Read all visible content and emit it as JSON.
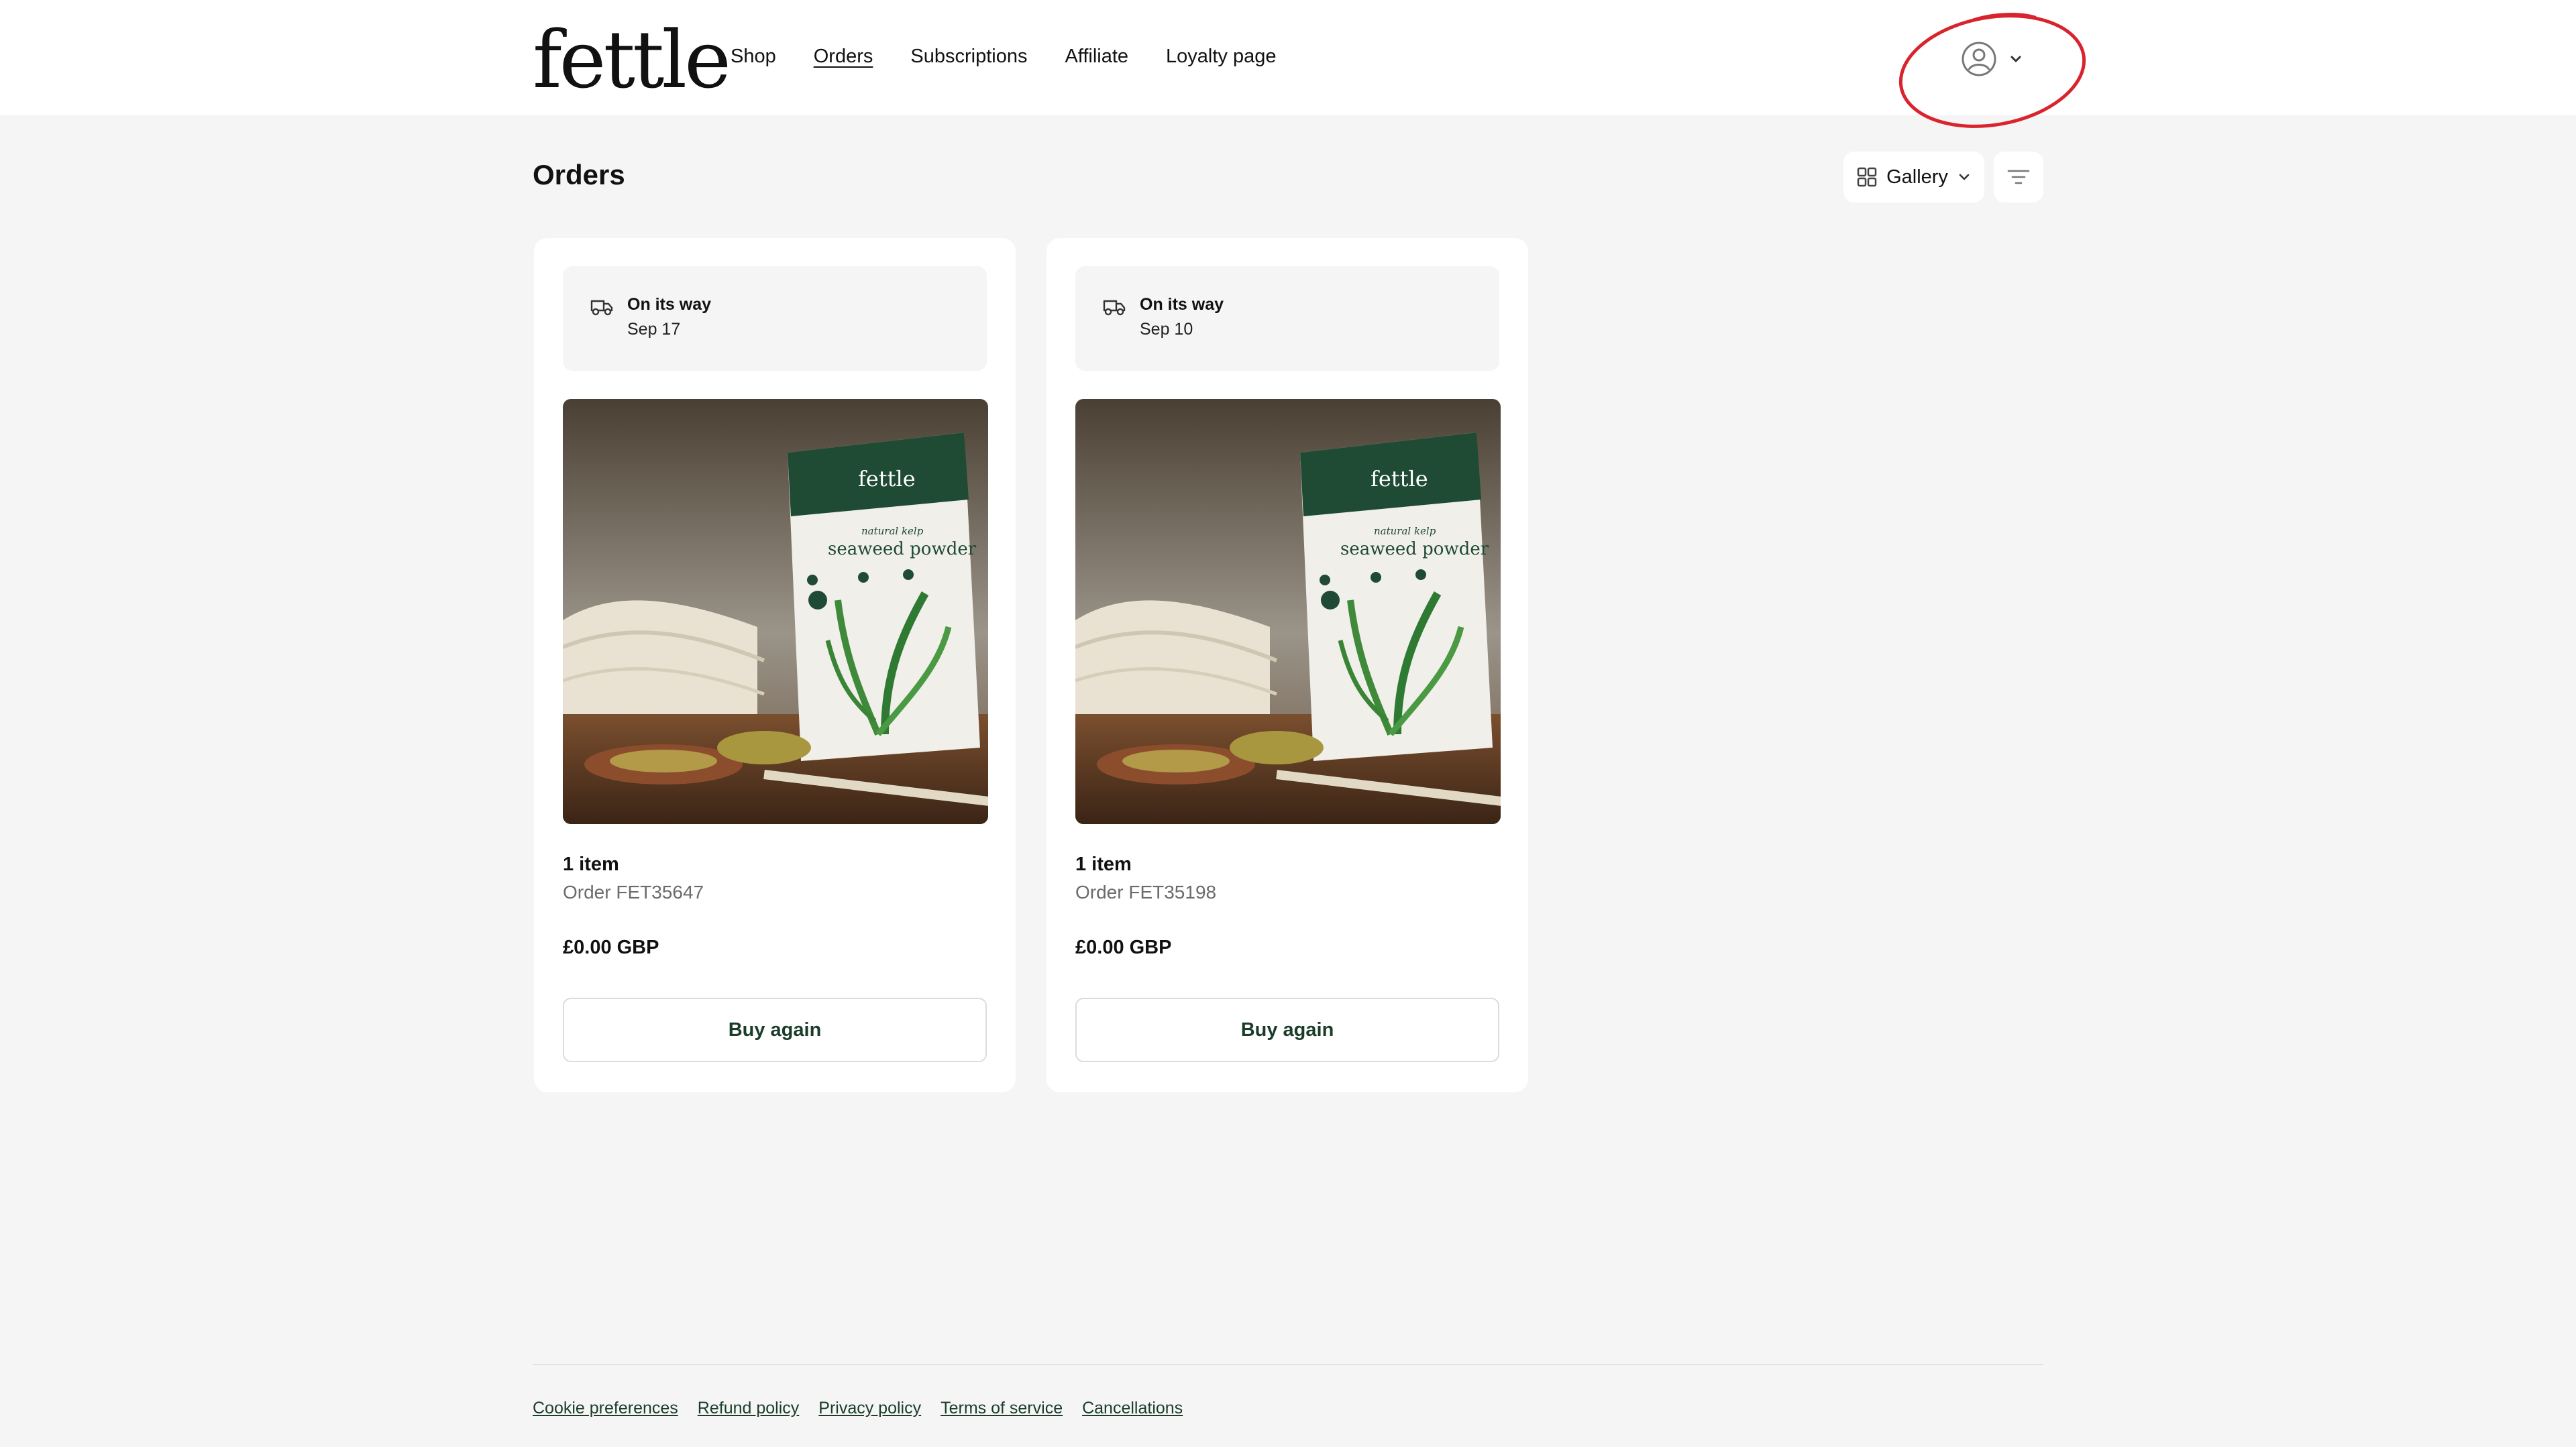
{
  "header": {
    "logo_text": "fettle",
    "nav": [
      {
        "label": "Shop",
        "active": false
      },
      {
        "label": "Orders",
        "active": true
      },
      {
        "label": "Subscriptions",
        "active": false
      },
      {
        "label": "Affiliate",
        "active": false
      },
      {
        "label": "Loyalty page",
        "active": false
      }
    ],
    "account_icon": "user-circle-icon",
    "annotation_color": "#d9232d"
  },
  "main": {
    "title": "Orders",
    "view_toggle_label": "Gallery",
    "orders": [
      {
        "status": "On its way",
        "date": "Sep 17",
        "items": "1 item",
        "order_number": "Order FET35647",
        "total": "£0.00 GBP",
        "button": "Buy again",
        "product_brand": "fettle",
        "product_subtitle": "natural kelp",
        "product_name": "seaweed powder"
      },
      {
        "status": "On its way",
        "date": "Sep 10",
        "items": "1 item",
        "order_number": "Order FET35198",
        "total": "£0.00 GBP",
        "button": "Buy again",
        "product_brand": "fettle",
        "product_subtitle": "natural kelp",
        "product_name": "seaweed powder"
      }
    ]
  },
  "footer": {
    "links": [
      "Cookie preferences",
      "Refund policy",
      "Privacy policy",
      "Terms of service",
      "Cancellations"
    ]
  },
  "colors": {
    "background": "#f5f5f5",
    "card": "#ffffff",
    "button_text": "#1a3d2a",
    "pouch_green": "#1f4a33"
  }
}
